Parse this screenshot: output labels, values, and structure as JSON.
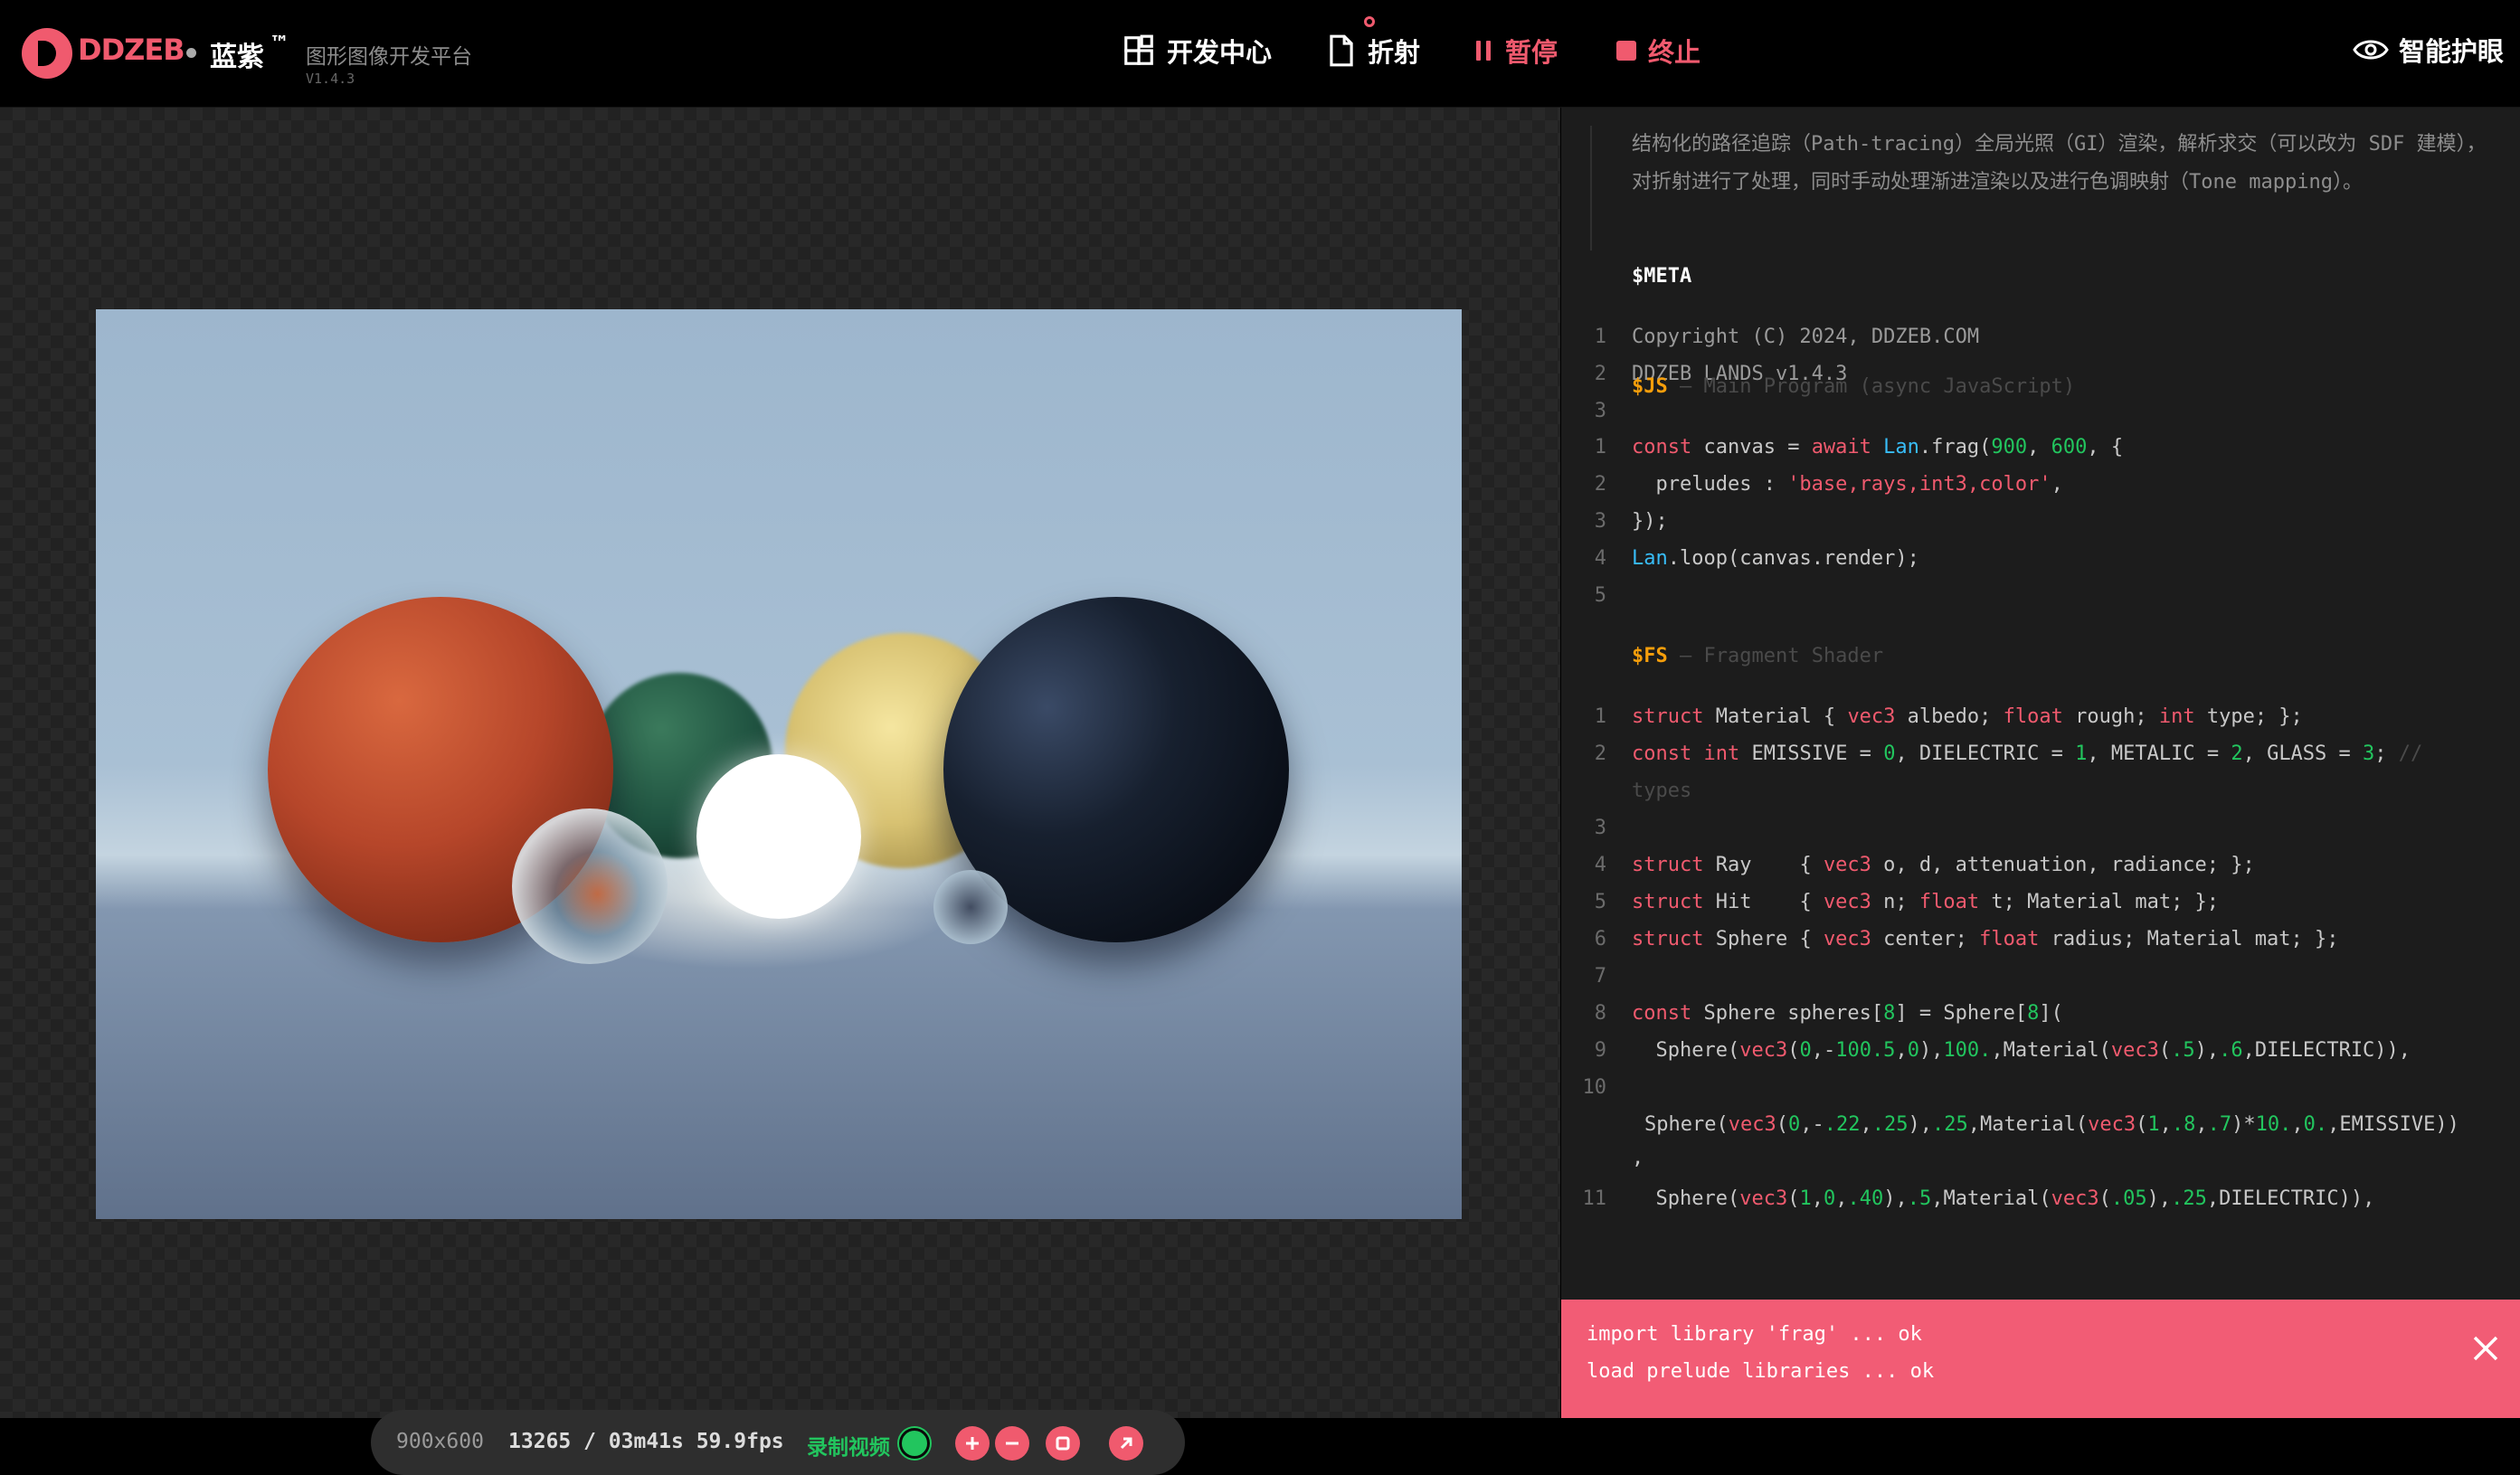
{
  "header": {
    "brand": "DDZEB",
    "brand_cn": "蓝紫",
    "trademark": "™",
    "subtitle": "图形图像开发平台",
    "version": "V1.4.3",
    "nav": {
      "dev_center": "开发中心",
      "refraction": "折射",
      "pause": "暂停",
      "stop": "终止"
    },
    "eye_care": "智能护眼",
    "icons": [
      "logo",
      "grid-icon",
      "file-icon",
      "pause-icon",
      "stop-icon",
      "eye-icon"
    ],
    "colors": {
      "accent": "#f05a6e",
      "success": "#22c55e",
      "code_number": "#22c55e",
      "code_builtin": "#38bdf8",
      "section_label": "#f59e0b"
    }
  },
  "status": {
    "resolution": "900x600",
    "frames": "13265 / 03m41s 59.9fps",
    "record_label": "录制视频",
    "record_on": true,
    "buttons": [
      "plus-icon",
      "minus-icon",
      "fit-icon",
      "open-external-icon"
    ]
  },
  "editor": {
    "intro": "结构化的路径追踪（Path-tracing）全局光照（GI）渲染，解析求交（可以改为 SDF 建模），对折射进行了处理，同时手动处理渐进渲染以及进行色调映射（Tone mapping）。",
    "meta_heading": "$META",
    "meta_lines": [
      "Copyright (C) 2024, DDZEB.COM",
      "DDZEB LANDS v1.4.3",
      ""
    ],
    "js_heading": "$JS",
    "js_desc": "— Main Program (async JavaScript)",
    "fs_heading": "$FS",
    "fs_desc": "— Fragment Shader",
    "line_numbers": [
      "1",
      "2",
      "3",
      "4",
      "5",
      "6",
      "7",
      "8",
      "9",
      "10",
      "11"
    ]
  },
  "toast": {
    "lines": [
      "import library 'frag' ... ok",
      "load prelude libraries ... ok"
    ]
  }
}
